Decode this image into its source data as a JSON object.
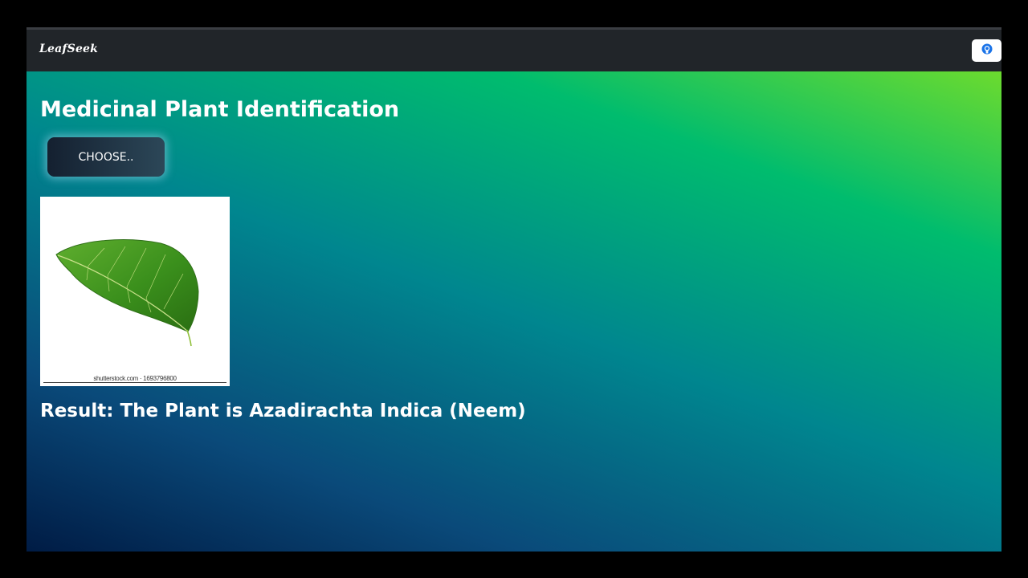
{
  "navbar": {
    "brand": "LeafSeek",
    "action_icon": "github-icon"
  },
  "main": {
    "title": "Medicinal Plant Identification",
    "choose_label": "CHOOSE..",
    "image": {
      "subject": "leaf-image",
      "watermark": "shutterstock.com · 1693796800"
    },
    "result": "Result: The Plant is Azadirachta Indica (Neem)"
  },
  "colors": {
    "navbar_bg": "#212529",
    "gradient_dark": "#001b44",
    "gradient_teal": "#00868f",
    "gradient_green": "#00bc6e",
    "gradient_lime": "#6cdb2e",
    "leaf_green": "#3a8f1c"
  }
}
